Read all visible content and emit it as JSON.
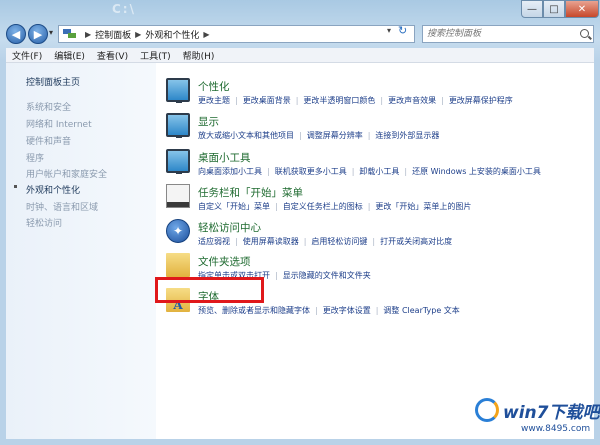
{
  "window": {
    "ghost_title": "C:\\",
    "controls": {
      "min": "—",
      "max": "□",
      "close": "✕"
    }
  },
  "nav": {
    "back": "◀",
    "forward": "▶",
    "history": "▾",
    "refresh": "↻",
    "address_dropdown": "▾"
  },
  "address": {
    "crumbs": [
      "控制面板",
      "外观和个性化"
    ]
  },
  "search": {
    "placeholder": "搜索控制面板"
  },
  "menu": [
    "文件(F)",
    "编辑(E)",
    "查看(V)",
    "工具(T)",
    "帮助(H)"
  ],
  "sidebar": {
    "home": "控制面板主页",
    "items": [
      "系统和安全",
      "网络和 Internet",
      "硬件和声音",
      "程序",
      "用户帐户和家庭安全",
      "外观和个性化",
      "时钟、语言和区域",
      "轻松访问"
    ]
  },
  "categories": [
    {
      "title": "个性化",
      "links": [
        "更改主题",
        "更改桌面背景",
        "更改半透明窗口颜色",
        "更改声音效果",
        "更改屏幕保护程序"
      ],
      "icon": "personalization-icon"
    },
    {
      "title": "显示",
      "links": [
        "放大或缩小文本和其他项目",
        "调整屏幕分辨率",
        "连接到外部显示器"
      ],
      "icon": "display-icon"
    },
    {
      "title": "桌面小工具",
      "links": [
        "向桌面添加小工具",
        "联机获取更多小工具",
        "卸载小工具",
        "还原 Windows 上安装的桌面小工具"
      ],
      "icon": "gadgets-icon"
    },
    {
      "title": "任务栏和「开始」菜单",
      "links": [
        "自定义「开始」菜单",
        "自定义任务栏上的图标",
        "更改「开始」菜单上的图片"
      ],
      "icon": "taskbar-icon"
    },
    {
      "title": "轻松访问中心",
      "links": [
        "适应弱视",
        "使用屏幕读取器",
        "启用轻松访问键",
        "打开或关闭高对比度"
      ],
      "icon": "ease-of-access-icon"
    },
    {
      "title": "文件夹选项",
      "links": [
        "指定单击或双击打开",
        "显示隐藏的文件和文件夹"
      ],
      "icon": "folder-options-icon"
    },
    {
      "title": "字体",
      "links": [
        "预览、删除或者显示和隐藏字体",
        "更改字体设置",
        "调整 ClearType 文本"
      ],
      "icon": "fonts-icon"
    }
  ],
  "watermark": {
    "brand": "win7下载吧",
    "url": "www.8495.com"
  },
  "colors": {
    "highlight": "#e0181b",
    "category_title": "#1e6a2f",
    "link": "#1e3f8a"
  }
}
